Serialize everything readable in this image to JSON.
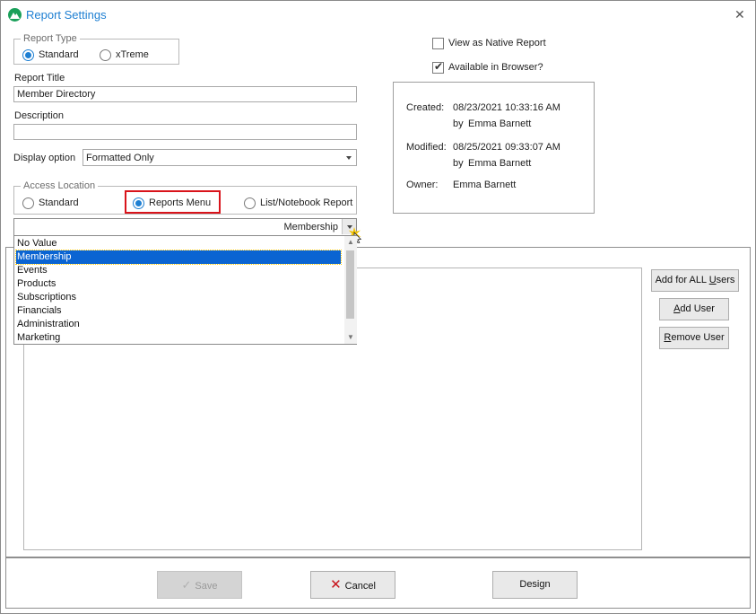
{
  "window": {
    "title": "Report Settings"
  },
  "report_type": {
    "legend": "Report Type",
    "options": [
      {
        "label": "Standard",
        "checked": true
      },
      {
        "label": "xTreme",
        "checked": false
      }
    ]
  },
  "report_title": {
    "label": "Report Title",
    "value": "Member Directory"
  },
  "description": {
    "label": "Description",
    "value": ""
  },
  "display_option": {
    "label": "Display option",
    "value": "Formatted Only"
  },
  "access_location": {
    "legend": "Access Location",
    "options": [
      {
        "label": "Standard",
        "checked": false
      },
      {
        "label": "Reports Menu",
        "checked": true
      },
      {
        "label": "List/Notebook Report",
        "checked": false
      }
    ]
  },
  "menu_combo": {
    "value": "Membership"
  },
  "dropdown": {
    "items": [
      "No Value",
      "Membership",
      "Events",
      "Products",
      "Subscriptions",
      "Financials",
      "Administration",
      "Marketing"
    ],
    "selected": "Membership"
  },
  "flags": {
    "native_report": {
      "label": "View as Native Report",
      "checked": false
    },
    "browser": {
      "label": "Available in Browser?",
      "checked": true
    }
  },
  "info": {
    "created_label": "Created:",
    "created_value": "08/23/2021 10:33:16 AM",
    "created_by_prefix": "by",
    "created_by": "Emma Barnett",
    "modified_label": "Modified:",
    "modified_value": "08/25/2021 09:33:07 AM",
    "modified_by_prefix": "by",
    "modified_by": "Emma Barnett",
    "owner_label": "Owner:",
    "owner_value": "Emma Barnett"
  },
  "users": {
    "add_all_prefix": "Add for ALL ",
    "add_all_underlined": "U",
    "add_all_suffix": "sers",
    "add_user_underlined": "A",
    "add_user_suffix": "dd User",
    "remove_user_underlined": "R",
    "remove_user_suffix": "emove User"
  },
  "footer": {
    "save_label": "Save",
    "cancel_label": "Cancel",
    "design_label": "Design"
  },
  "colors": {
    "accent": "#1e7fd2",
    "selection": "#0a64d2",
    "highlight_box": "#d9141b",
    "cancel_x": "#c8141c"
  }
}
